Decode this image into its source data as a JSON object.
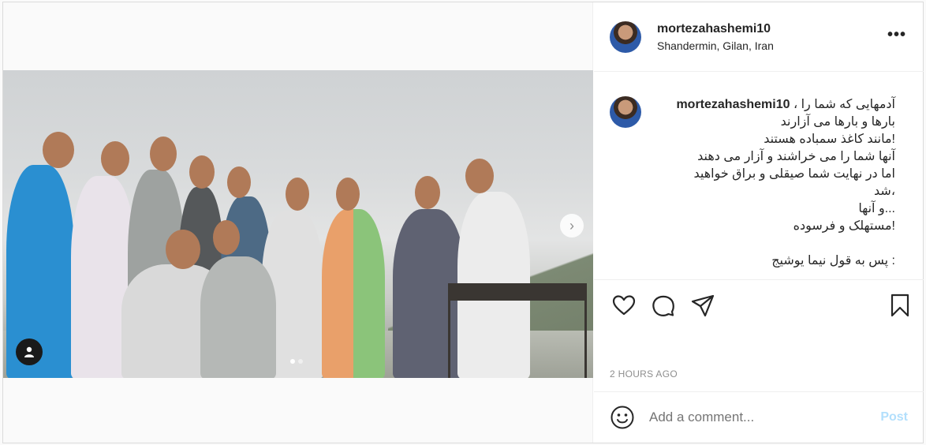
{
  "post": {
    "username": "mortezahashemi10",
    "location": "Shandermin, Gilan, Iran",
    "more_label": "•••",
    "caption_lines": [
      "آدمهایی که شما را ،",
      "بارها و بارها می آزارند",
      "!مانند کاغذ سمباده هستند",
      "آنها شما را می خراشند و آزار می دهند",
      "اما در نهایت شما صیقلی و براق خواهید",
      "،شد",
      "...و آنها",
      "!مستهلک و فرسوده",
      "",
      ": پس به قول نیما یوشیج"
    ],
    "time_ago": "2 HOURS AGO",
    "comment_placeholder": "Add a comment...",
    "post_label": "Post",
    "next_label": "›"
  },
  "icons": {
    "like": "heart-icon",
    "comment": "comment-icon",
    "share": "paper-plane-icon",
    "save": "bookmark-icon",
    "emoji": "smiley-icon",
    "user_tag": "user-icon"
  },
  "colors": {
    "accent_disabled": "#b2dffc",
    "muted": "#8e8e8e",
    "text": "#262626"
  },
  "carousel": {
    "total": 2,
    "active": 0
  }
}
